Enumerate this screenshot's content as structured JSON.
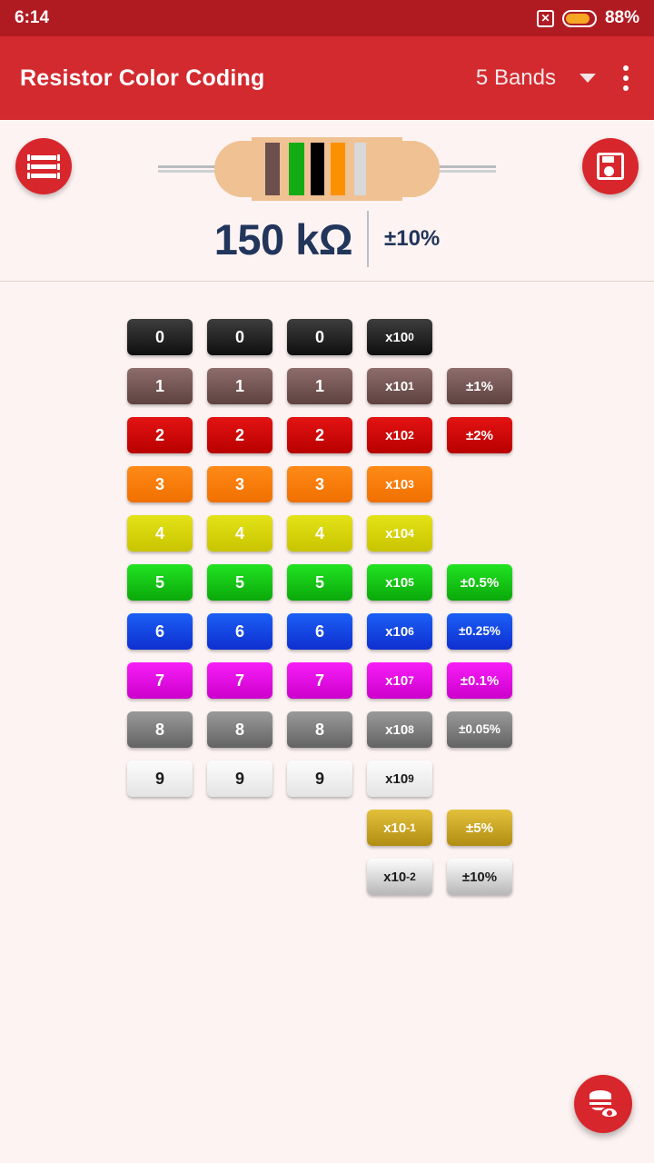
{
  "status_bar": {
    "time": "6:14",
    "no_sim_glyph": "✕",
    "battery_percent": "88%",
    "battery_level": 88
  },
  "app_bar": {
    "title": "Resistor Color Coding",
    "band_mode": "5 Bands",
    "caret_icon": "chevron-down-icon",
    "overflow_icon": "more-vertical-icon"
  },
  "resistor_panel": {
    "bands_button_icon": "bands-icon",
    "save_button_icon": "save-icon",
    "value": "150 kΩ",
    "tolerance": "±10%",
    "band_colors": [
      "#6d4f4d",
      "#14ac14",
      "#000000",
      "#fb9100",
      "#d8d8d8"
    ],
    "band_names": [
      "brown",
      "green",
      "black",
      "orange",
      "silver"
    ],
    "body_color": "#efc193",
    "lead_color": "#b9bcbe"
  },
  "color_grid": {
    "rows": [
      {
        "color_name": "black",
        "swatch_class": "c-black",
        "digit1": "0",
        "digit2": "0",
        "digit3": "0",
        "multiplier": "x10",
        "multiplier_exp": "0",
        "tolerance": null
      },
      {
        "color_name": "brown",
        "swatch_class": "c-brown",
        "digit1": "1",
        "digit2": "1",
        "digit3": "1",
        "multiplier": "x10",
        "multiplier_exp": "1",
        "tolerance": "±1%"
      },
      {
        "color_name": "red",
        "swatch_class": "c-red",
        "digit1": "2",
        "digit2": "2",
        "digit3": "2",
        "multiplier": "x10",
        "multiplier_exp": "2",
        "tolerance": "±2%"
      },
      {
        "color_name": "orange",
        "swatch_class": "c-orange",
        "digit1": "3",
        "digit2": "3",
        "digit3": "3",
        "multiplier": "x10",
        "multiplier_exp": "3",
        "tolerance": null
      },
      {
        "color_name": "yellow",
        "swatch_class": "c-yellow",
        "digit1": "4",
        "digit2": "4",
        "digit3": "4",
        "multiplier": "x10",
        "multiplier_exp": "4",
        "tolerance": null
      },
      {
        "color_name": "green",
        "swatch_class": "c-green",
        "digit1": "5",
        "digit2": "5",
        "digit3": "5",
        "multiplier": "x10",
        "multiplier_exp": "5",
        "tolerance": "±0.5%"
      },
      {
        "color_name": "blue",
        "swatch_class": "c-blue",
        "digit1": "6",
        "digit2": "6",
        "digit3": "6",
        "multiplier": "x10",
        "multiplier_exp": "6",
        "tolerance": "±0.25%"
      },
      {
        "color_name": "violet",
        "swatch_class": "c-violet",
        "digit1": "7",
        "digit2": "7",
        "digit3": "7",
        "multiplier": "x10",
        "multiplier_exp": "7",
        "tolerance": "±0.1%"
      },
      {
        "color_name": "gray",
        "swatch_class": "c-gray",
        "digit1": "8",
        "digit2": "8",
        "digit3": "8",
        "multiplier": "x10",
        "multiplier_exp": "8",
        "tolerance": "±0.05%"
      },
      {
        "color_name": "white",
        "swatch_class": "c-white",
        "dark_text": true,
        "digit1": "9",
        "digit2": "9",
        "digit3": "9",
        "multiplier": "x10",
        "multiplier_exp": "9",
        "tolerance": null
      },
      {
        "color_name": "gold",
        "swatch_class": "c-gold",
        "digit1": null,
        "digit2": null,
        "digit3": null,
        "multiplier": "x10",
        "multiplier_exp": "-1",
        "tolerance": "±5%"
      },
      {
        "color_name": "silver",
        "swatch_class": "c-silver",
        "dark_text": true,
        "digit1": null,
        "digit2": null,
        "digit3": null,
        "multiplier": "x10",
        "multiplier_exp": "-2",
        "tolerance": "±10%"
      }
    ]
  },
  "bottom_fab": {
    "icon": "database-view-icon"
  },
  "theme": {
    "status_bar_bg": "#b01b22",
    "app_bar_bg": "#d32a2f",
    "accent": "#d8262d",
    "page_bg": "#fdf3f2",
    "value_text": "#22355b"
  }
}
